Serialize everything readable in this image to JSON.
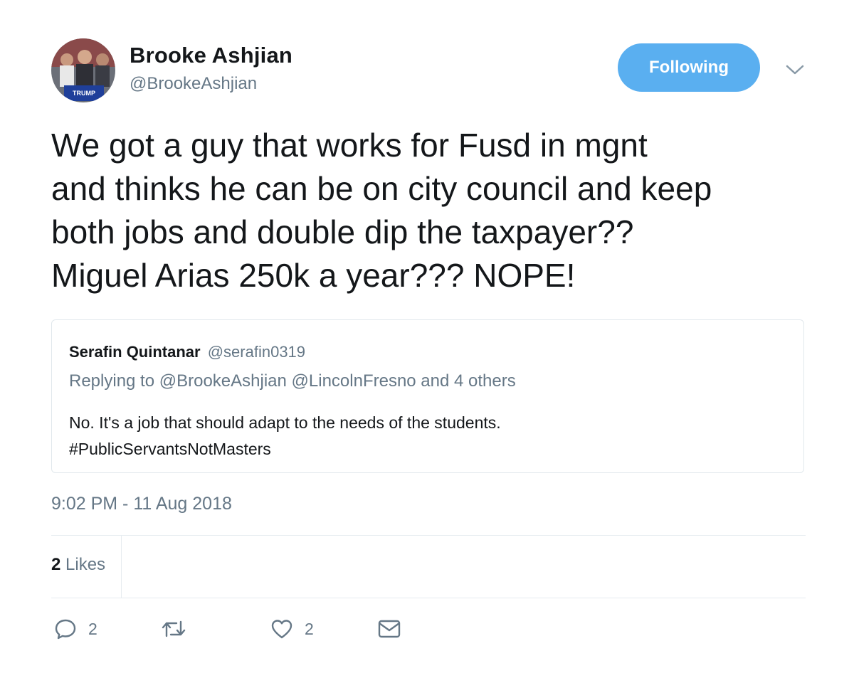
{
  "author": {
    "display_name": "Brooke Ashjian",
    "handle": "@BrookeAshjian",
    "avatar_sign_text": "TRUMP"
  },
  "follow_button": {
    "label": "Following",
    "color": "#5aaff0"
  },
  "tweet": {
    "text": "We got a guy that works for Fusd in mgnt\nand thinks he can be on city council and keep\nboth jobs and double dip the taxpayer??\nMiguel Arias 250k a year??? NOPE!",
    "timestamp": "9:02 PM - 11 Aug 2018"
  },
  "quoted_tweet": {
    "name": "Serafin Quintanar",
    "handle": "@serafin0319",
    "replying_to": "Replying to @BrookeAshjian @LincolnFresno and 4 others",
    "text": "No. It's a job that should adapt to the needs of the students.\n#PublicServantsNotMasters"
  },
  "stats": {
    "likes_count": "2",
    "likes_label": "Likes"
  },
  "actions": {
    "reply": {
      "icon": "reply-icon",
      "count": "2"
    },
    "retweet": {
      "icon": "retweet-icon",
      "count": ""
    },
    "like": {
      "icon": "heart-icon",
      "count": "2"
    },
    "message": {
      "icon": "envelope-icon"
    }
  },
  "colors": {
    "text_primary": "#14171a",
    "text_secondary": "#657786",
    "border": "#e1e8ed",
    "accent": "#5aaff0"
  }
}
